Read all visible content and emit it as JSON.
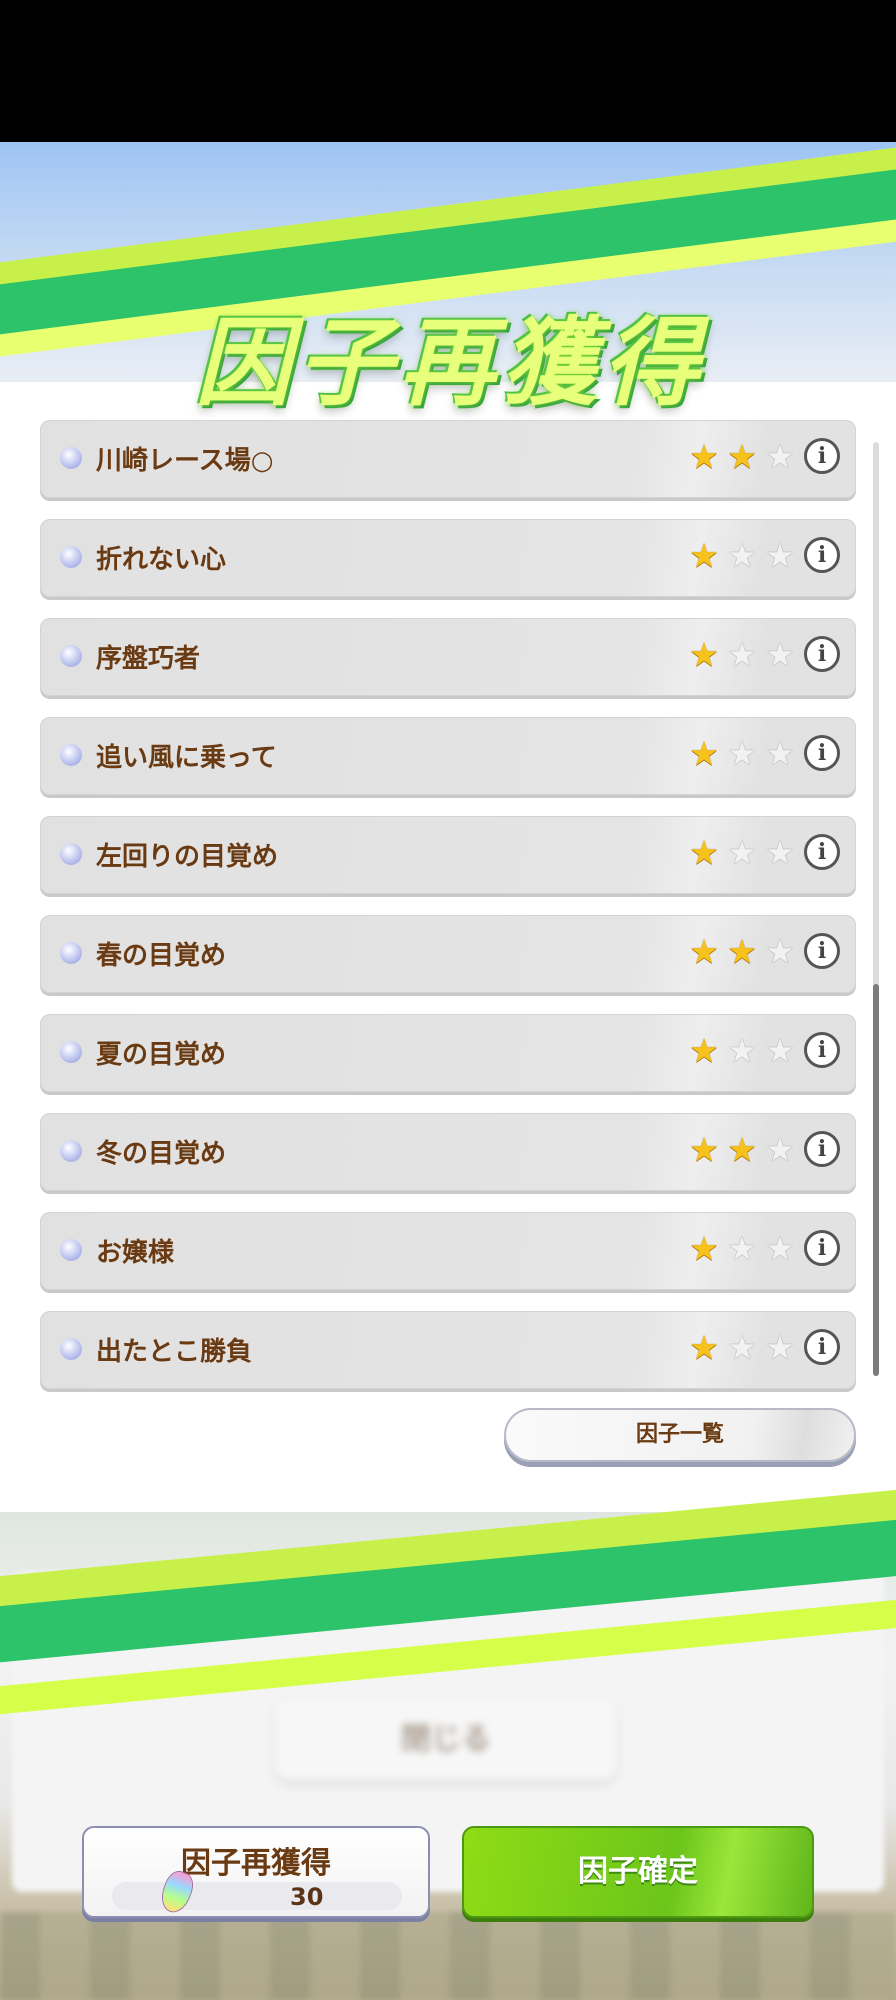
{
  "screen_title": "因子再獲得",
  "factors": [
    {
      "name": "川崎レース場○",
      "stars": 2
    },
    {
      "name": "折れない心",
      "stars": 1
    },
    {
      "name": "序盤巧者",
      "stars": 1
    },
    {
      "name": "追い風に乗って",
      "stars": 1
    },
    {
      "name": "左回りの目覚め",
      "stars": 1
    },
    {
      "name": "春の目覚め",
      "stars": 2
    },
    {
      "name": "夏の目覚め",
      "stars": 1
    },
    {
      "name": "冬の目覚め",
      "stars": 2
    },
    {
      "name": "お嬢様",
      "stars": 1
    },
    {
      "name": "出たとこ勝負",
      "stars": 1
    }
  ],
  "max_stars": 3,
  "info_icon": "i",
  "factor_list_button": "因子一覧",
  "background_close_button": "閉じる",
  "reacquire_button": {
    "label": "因子再獲得",
    "cost": "30",
    "cost_icon": "carrot-icon"
  },
  "confirm_button": "因子確定",
  "colors": {
    "text_brown": "#6a3a12",
    "green_accent": "#2cc36a",
    "lime_accent": "#c8f04a",
    "confirm_green": "#7cd11a",
    "star_gold": "#f7c21b"
  }
}
